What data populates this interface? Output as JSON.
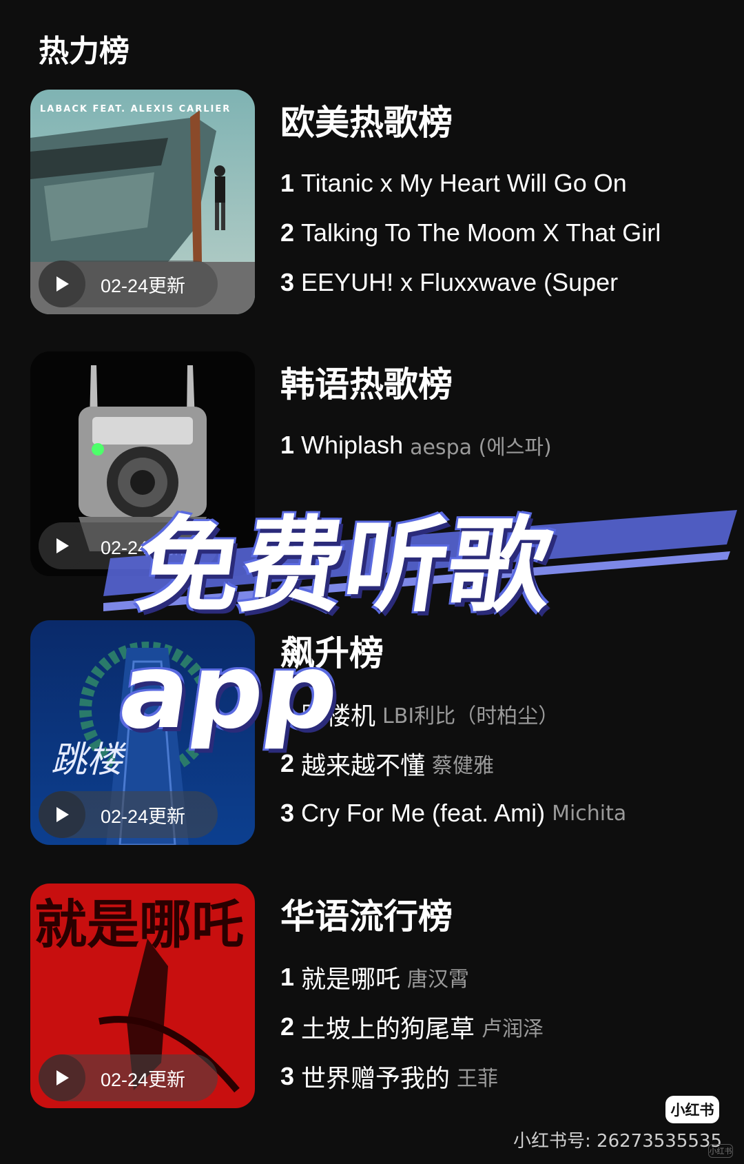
{
  "page_title": "热力榜",
  "charts": [
    {
      "name": "欧美热歌榜",
      "update_label": "02-24更新",
      "cover_text": "LABACK FEAT. ALEXIS CARLIER",
      "tracks": [
        {
          "rank": "1",
          "title": "Titanic x My Heart Will Go On",
          "artist": ""
        },
        {
          "rank": "2",
          "title": "Talking To The Moom X That Girl",
          "artist": ""
        },
        {
          "rank": "3",
          "title": "EEYUH! x Fluxxwave (Super",
          "artist": ""
        }
      ]
    },
    {
      "name": "韩语热歌榜",
      "update_label": "02-24更新",
      "cover_text": "",
      "tracks": [
        {
          "rank": "1",
          "title": "Whiplash",
          "artist": "aespa (에스파)"
        }
      ]
    },
    {
      "name": "飙升榜",
      "update_label": "02-24更新",
      "cover_text": "跳楼",
      "tracks": [
        {
          "rank": "1",
          "title": "跳楼机",
          "artist": "LBI利比（时柏尘）"
        },
        {
          "rank": "2",
          "title": "越来越不懂",
          "artist": "蔡健雅"
        },
        {
          "rank": "3",
          "title": "Cry For Me (feat. Ami)",
          "artist": "Michita"
        }
      ]
    },
    {
      "name": "华语流行榜",
      "update_label": "02-24更新",
      "cover_text": "就是哪吒",
      "tracks": [
        {
          "rank": "1",
          "title": "就是哪吒",
          "artist": "唐汉霄"
        },
        {
          "rank": "2",
          "title": "土坡上的狗尾草",
          "artist": "卢润泽"
        },
        {
          "rank": "3",
          "title": "世界赠予我的",
          "artist": "王菲"
        }
      ]
    }
  ],
  "banner_text": "免费听歌app",
  "watermark": {
    "badge": "小红书",
    "id_text": "小红书号: 26273535535",
    "corner": "小红书"
  },
  "colors": {
    "background": "#0e0e0e",
    "artist_gray": "#9a9a9a",
    "banner_stripe": "#5a6ae0"
  }
}
